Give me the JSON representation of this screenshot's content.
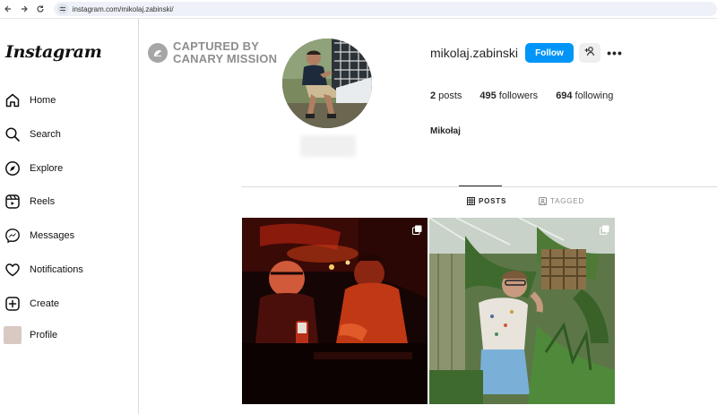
{
  "browser": {
    "url": "instagram.com/mikolaj.zabinski/"
  },
  "sidebar": {
    "logo": "Instagram",
    "items": [
      {
        "label": "Home",
        "icon": "home-icon"
      },
      {
        "label": "Search",
        "icon": "search-icon"
      },
      {
        "label": "Explore",
        "icon": "compass-icon"
      },
      {
        "label": "Reels",
        "icon": "reels-icon"
      },
      {
        "label": "Messages",
        "icon": "messenger-icon"
      },
      {
        "label": "Notifications",
        "icon": "heart-icon"
      },
      {
        "label": "Create",
        "icon": "plus-square-icon"
      },
      {
        "label": "Profile",
        "icon": "avatar"
      }
    ]
  },
  "watermark": {
    "line1": "CAPTURED BY",
    "line2": "CANARY MISSION"
  },
  "profile": {
    "username": "mikolaj.zabinski",
    "follow_label": "Follow",
    "more_label": "•••",
    "posts_count": "2",
    "posts_label": "posts",
    "followers_count": "495",
    "followers_label": "followers",
    "following_count": "694",
    "following_label": "following",
    "full_name": "Mikołaj"
  },
  "tabs": {
    "posts": "POSTS",
    "tagged": "TAGGED"
  },
  "colors": {
    "accent": "#0095f6",
    "text": "#262626",
    "muted": "#8e8e8e",
    "border": "#dbdbdb"
  }
}
